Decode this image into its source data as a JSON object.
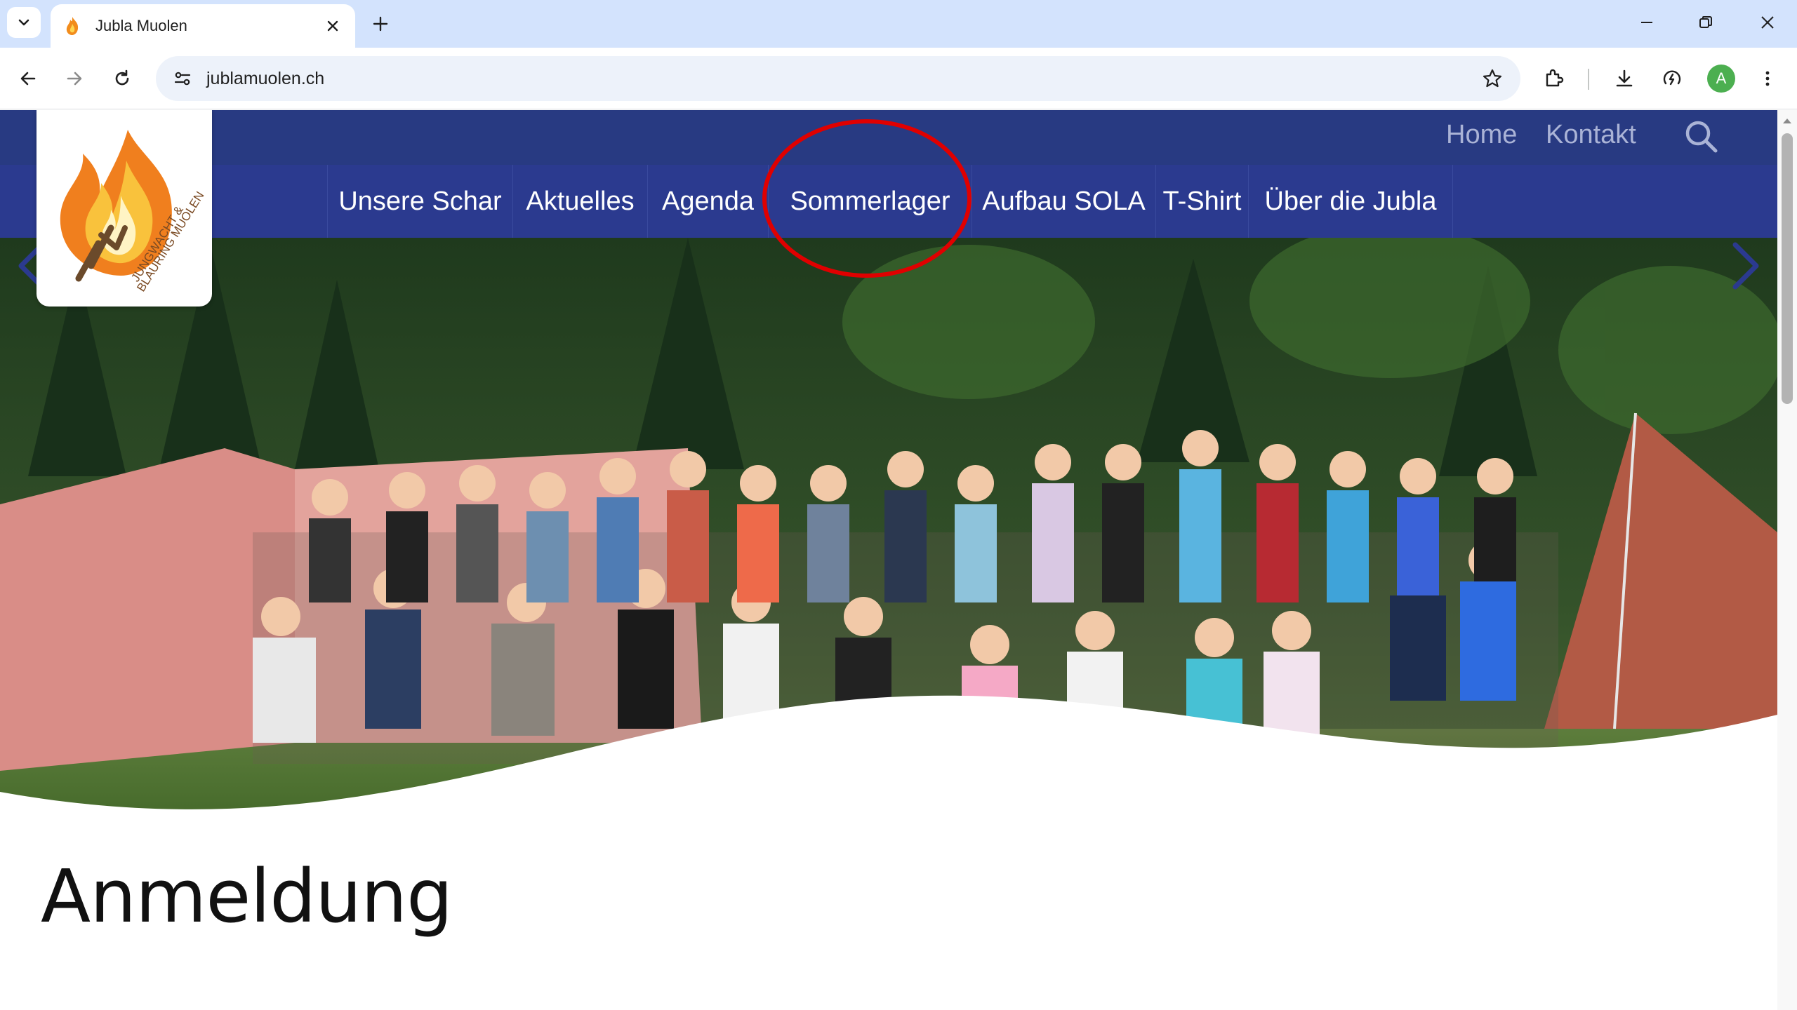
{
  "browser": {
    "tab_title": "Jubla Muolen",
    "url": "jublamuolen.ch",
    "profile_initial": "A"
  },
  "site": {
    "top_links": [
      "Home",
      "Kontakt"
    ],
    "nav": [
      "Unsere Schar",
      "Aktuelles",
      "Agenda",
      "Sommerlager",
      "Aufbau SOLA",
      "T-Shirt",
      "Über die Jubla"
    ],
    "logo_text_line1": "JUNGWACHT &",
    "logo_text_line2": "BLAURING MUOLEN",
    "heading": "Anmeldung"
  },
  "colors": {
    "topbar": "#283a82",
    "navbar": "#2b3a8f",
    "annotation": "#e00000"
  },
  "icons": [
    "tab-list-icon",
    "flame-favicon-icon",
    "close-icon",
    "plus-icon",
    "minimize-icon",
    "restore-icon",
    "back-icon",
    "forward-icon",
    "reload-icon",
    "site-info-icon",
    "star-icon",
    "extensions-icon",
    "download-icon",
    "performance-icon",
    "menu-icon",
    "search-icon",
    "chevron-left-icon",
    "chevron-right-icon"
  ]
}
